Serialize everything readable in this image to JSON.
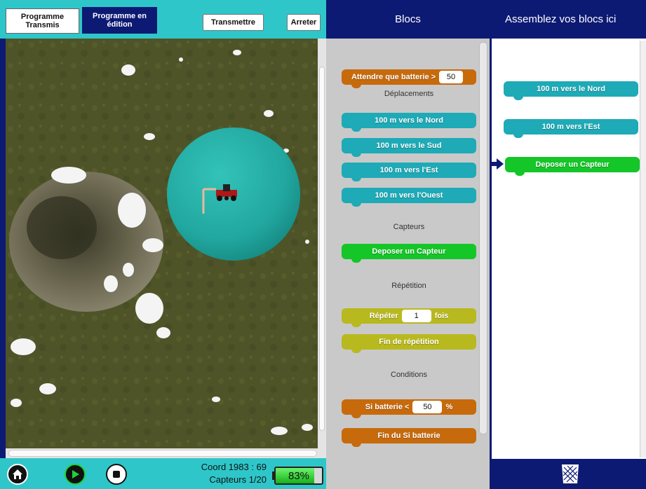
{
  "tabs": {
    "transmis": "Programme Transmis",
    "edition": "Programme en édition"
  },
  "toolbar": {
    "transmettre": "Transmettre",
    "arreter": "Arreter"
  },
  "headers": {
    "blocs": "Blocs",
    "assemble": "Assemblez vos blocs ici"
  },
  "status": {
    "coord": "Coord 1983 : 69",
    "capteurs": "Capteurs 1/20",
    "battery": "83%",
    "battery_level": 0.83
  },
  "palette": {
    "wait_battery": {
      "label": "Attendre que batterie >",
      "value": "50"
    },
    "section_deplacements": "Déplacements",
    "nord": "100 m vers le Nord",
    "sud": "100 m vers le Sud",
    "est": "100 m vers l'Est",
    "ouest": "100 m vers l'Ouest",
    "section_capteurs": "Capteurs",
    "deposer": "Deposer un Capteur",
    "section_repetition": "Répétition",
    "repeter": {
      "label": "Répéter",
      "value": "1",
      "suffix": "fois"
    },
    "fin_repetition": "Fin de répétition",
    "section_conditions": "Conditions",
    "si_batterie": {
      "label": "Si batterie <",
      "value": "50",
      "suffix": "%"
    },
    "fin_si": "Fin du Si batterie"
  },
  "workspace": {
    "blocks": [
      "100 m vers le Nord",
      "100 m vers l'Est",
      "Deposer un Capteur"
    ]
  },
  "colors": {
    "accent": "#2ec6c9",
    "navy": "#0d1a73",
    "block_teal": "#1eaab7",
    "block_green": "#15c628",
    "block_olive": "#b8b91e",
    "block_orange": "#c76a0c"
  },
  "icons": [
    "home-icon",
    "play-icon",
    "stop-icon",
    "battery-icon",
    "trash-icon",
    "arrow-right-icon",
    "rover-icon"
  ]
}
